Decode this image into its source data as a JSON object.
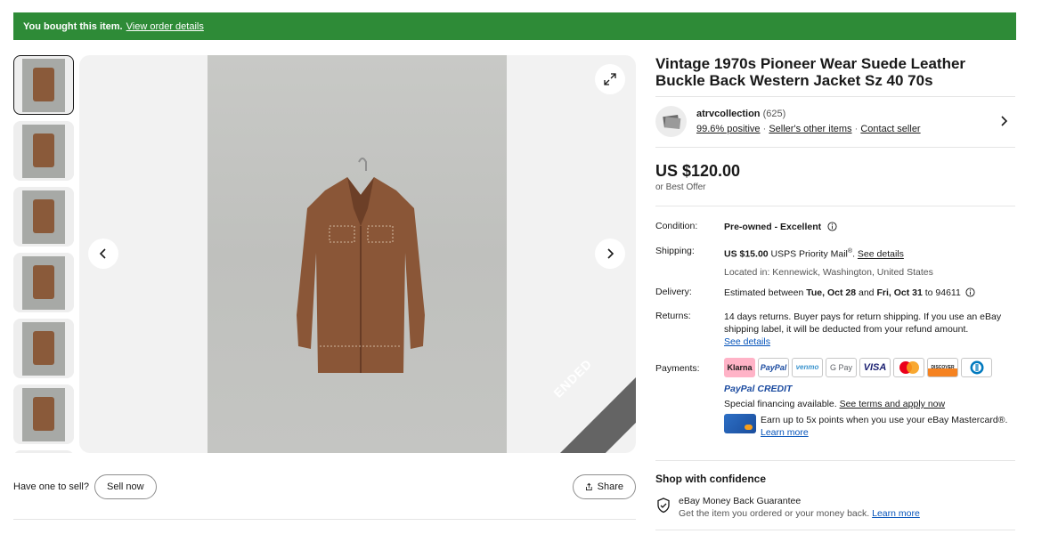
{
  "banner": {
    "bought": "You bought this item.",
    "link": "View order details"
  },
  "gallery": {
    "ribbon": "ENDED",
    "thumbnails": [
      "jacket-front",
      "jacket-front-2",
      "jacket-sleeve",
      "jacket-detail",
      "jacket-back",
      "jacket-label"
    ]
  },
  "sell": {
    "prompt": "Have one to sell?",
    "button": "Sell now"
  },
  "share": {
    "label": "Share"
  },
  "listing": {
    "title": "Vintage 1970s Pioneer Wear Suede Leather Buckle Back Western Jacket Sz 40 70s"
  },
  "seller": {
    "name": "atrvcollection",
    "count": "(625)",
    "positive": "99.6% positive",
    "other_items": "Seller's other items",
    "contact": "Contact seller"
  },
  "price": {
    "amount": "US $120.00",
    "best_offer": "or Best Offer"
  },
  "details": {
    "condition_label": "Condition:",
    "condition_value": "Pre-owned - Excellent",
    "shipping_label": "Shipping:",
    "shipping_price": "US $15.00",
    "shipping_method": "USPS Priority Mail",
    "shipping_link": "See details",
    "located": "Located in: Kennewick, Washington, United States",
    "delivery_label": "Delivery:",
    "delivery_pre": "Estimated between",
    "delivery_from": "Tue, Oct 28",
    "delivery_and": "and",
    "delivery_to": "Fri, Oct 31",
    "delivery_zip": "to 94611",
    "returns_label": "Returns:",
    "returns_text": "14 days returns. Buyer pays for return shipping. If you use an eBay shipping label, it will be deducted from your refund amount.",
    "returns_link": "See details",
    "payments_label": "Payments:",
    "payment_methods": [
      "Klarna",
      "PayPal",
      "venmo",
      "G Pay",
      "VISA",
      "Mastercard",
      "DISCOVER",
      "Diners"
    ],
    "paypal_credit": "PayPal CREDIT",
    "financing": "Special financing available.",
    "financing_link": "See terms and apply now",
    "card_text": "Earn up to 5x points when you use your eBay Mastercard®.",
    "card_link": "Learn more"
  },
  "confidence": {
    "title": "Shop with confidence",
    "mbg_title": "eBay Money Back Guarantee",
    "mbg_text": "Get the item you ordered or your money back.",
    "mbg_link": "Learn more"
  },
  "colors": {
    "banner": "#2e8b37",
    "link": "#0654ba"
  }
}
